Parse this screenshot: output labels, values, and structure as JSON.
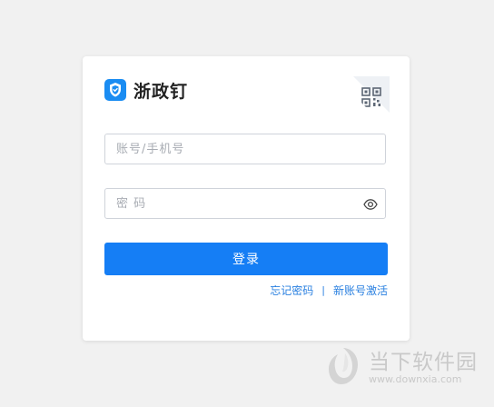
{
  "app": {
    "name": "浙政钉"
  },
  "login": {
    "account_placeholder": "账号/手机号",
    "password_placeholder": "密 码",
    "submit_label": "登录",
    "forgot_password_label": "忘记密码",
    "separator": "|",
    "activate_label": "新账号激活"
  },
  "watermark": {
    "name": "当下软件园",
    "url": "www.downxia.com"
  },
  "colors": {
    "accent": "#157ef5",
    "link": "#2a80e0",
    "background": "#f1f1f1"
  },
  "icons": {
    "app_logo": "shield-icon",
    "qr_toggle": "qr-code-icon",
    "password_visibility": "eye-icon"
  }
}
